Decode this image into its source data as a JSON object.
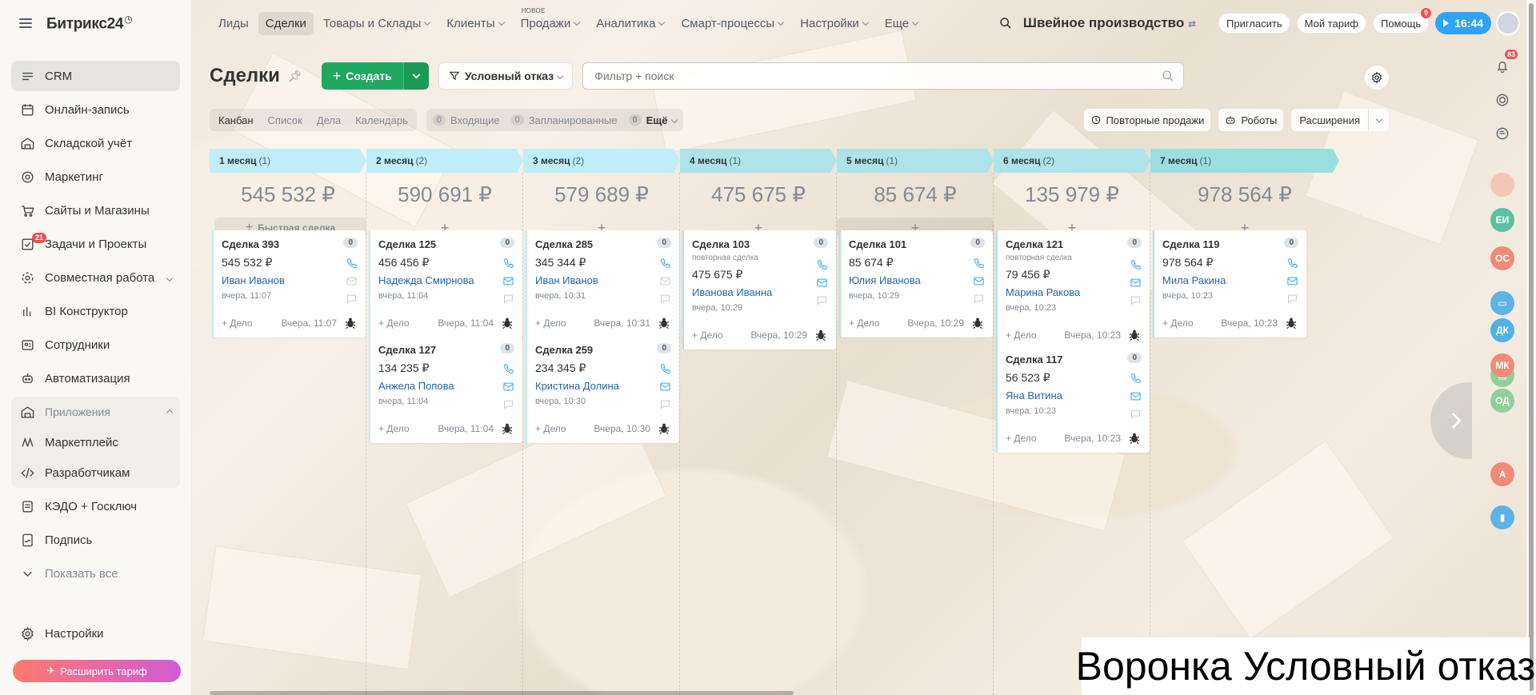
{
  "app": {
    "logo": "Битрикс24",
    "company": "Швейное производство"
  },
  "sidebar": {
    "items": [
      {
        "label": "CRM",
        "icon": "crm-icon",
        "active": true
      },
      {
        "label": "Онлайн-запись",
        "icon": "calendar-icon"
      },
      {
        "label": "Складской учёт",
        "icon": "warehouse-icon"
      },
      {
        "label": "Маркетинг",
        "icon": "marketing-icon"
      },
      {
        "label": "Сайты и Магазины",
        "icon": "cart-icon"
      },
      {
        "label": "Задачи и Проекты",
        "icon": "tasks-icon",
        "badge": "21"
      },
      {
        "label": "Совместная работа",
        "icon": "collab-icon"
      },
      {
        "label": "BI Конструктор",
        "icon": "bi-icon"
      },
      {
        "label": "Сотрудники",
        "icon": "employees-icon"
      },
      {
        "label": "Автоматизация",
        "icon": "automation-icon"
      }
    ],
    "group": {
      "header": "Приложения",
      "items": [
        {
          "label": "Маркетплейс",
          "icon": "marketplace-icon"
        },
        {
          "label": "Разработчикам",
          "icon": "code-icon"
        }
      ]
    },
    "after": [
      {
        "label": "КЭДО + Госключ",
        "icon": "doc-icon"
      },
      {
        "label": "Подпись",
        "icon": "signature-icon"
      },
      {
        "label": "Показать все",
        "icon": "chevron-down-icon",
        "muted": true
      }
    ],
    "settings": "Настройки",
    "upgrade": "Расширить тариф"
  },
  "topbar": {
    "menu": [
      {
        "label": "Лиды"
      },
      {
        "label": "Сделки",
        "active": true
      },
      {
        "label": "Товары и Склады",
        "caret": true
      },
      {
        "label": "Клиенты",
        "caret": true
      },
      {
        "label": "Продажи",
        "caret": true,
        "new": "НОВОЕ"
      },
      {
        "label": "Аналитика",
        "caret": true
      },
      {
        "label": "Смарт-процессы",
        "caret": true
      },
      {
        "label": "Настройки",
        "caret": true
      },
      {
        "label": "Еще",
        "caret": true
      }
    ],
    "invite": "Пригласить",
    "tariff": "Мой тариф",
    "help": "Помощь",
    "help_badge": "9",
    "time": "16:44"
  },
  "toolbar": {
    "title": "Сделки",
    "create": "Создать",
    "funnel": "Условный отказ",
    "filter_placeholder": "Фильтр + поиск"
  },
  "views": {
    "tabs": [
      "Канбан",
      "Список",
      "Дела",
      "Календарь"
    ],
    "counters": [
      {
        "num": "0",
        "label": "Входящие"
      },
      {
        "num": "0",
        "label": "Запланированные"
      },
      {
        "num": "0",
        "label": "Ещё"
      }
    ],
    "repeat_sales": "Повторные продажи",
    "robots": "Роботы",
    "extensions": "Расширения"
  },
  "kanban": {
    "fast_deal": "Быстрая сделка",
    "add_activity": "+ Дело",
    "columns": [
      {
        "name": "1 месяц",
        "count": "(1)",
        "sum": "545 532 ₽",
        "color": "#bfeefa",
        "cards": [
          {
            "title": "Сделка 393",
            "sum": "545 532 ₽",
            "client": "Иван Иванов",
            "date": "вчера, 11:07",
            "footer": "Вчера, 11:07",
            "cnt": "0"
          }
        ]
      },
      {
        "name": "2 месяц",
        "count": "(2)",
        "sum": "590 691 ₽",
        "color": "#bfeefa",
        "cards": [
          {
            "title": "Сделка 125",
            "sum": "456 456 ₽",
            "client": "Надежда Смирнова",
            "date": "вчера, 11:04",
            "footer": "Вчера, 11:04",
            "cnt": "0"
          },
          {
            "title": "Сделка 127",
            "sum": "134 235 ₽",
            "client": "Анжела Попова",
            "date": "вчера, 11:04",
            "footer": "Вчера, 11:04",
            "cnt": "0"
          }
        ]
      },
      {
        "name": "3 месяц",
        "count": "(2)",
        "sum": "579 689 ₽",
        "color": "#bfeefa",
        "cards": [
          {
            "title": "Сделка 285",
            "sum": "345 344 ₽",
            "client": "Иван Иванов",
            "date": "вчера, 10:31",
            "footer": "Вчера, 10:31",
            "cnt": "0"
          },
          {
            "title": "Сделка 259",
            "sum": "234 345 ₽",
            "client": "Кристина Долина",
            "date": "вчера, 10:30",
            "footer": "Вчера, 10:30",
            "cnt": "0"
          }
        ]
      },
      {
        "name": "4 месяц",
        "count": "(1)",
        "sum": "475 675 ₽",
        "color": "#aee4e9",
        "cards": [
          {
            "title": "Сделка 103",
            "sub": "повторная сделка",
            "sum": "475 675 ₽",
            "client": "Иванова Иванна",
            "date": "вчера, 10:29",
            "footer": "Вчера, 10:29",
            "cnt": "0"
          }
        ]
      },
      {
        "name": "5 месяц",
        "count": "(1)",
        "sum": "85 674 ₽",
        "color": "#aee4e9",
        "cards": [
          {
            "title": "Сделка 101",
            "sum": "85 674 ₽",
            "client": "Юлия Иванова",
            "date": "вчера, 10:29",
            "footer": "Вчера, 10:29",
            "cnt": "0"
          }
        ]
      },
      {
        "name": "6 месяц",
        "count": "(2)",
        "sum": "135 979 ₽",
        "color": "#aee4e9",
        "cards": [
          {
            "title": "Сделка 121",
            "sub": "повторная сделка",
            "sum": "79 456 ₽",
            "client": "Марина Ракова",
            "date": "вчера, 10:23",
            "footer": "Вчера, 10:23",
            "cnt": "0"
          },
          {
            "title": "Сделка 117",
            "sum": "56 523 ₽",
            "client": "Яна Витина",
            "date": "вчера, 10:23",
            "footer": "Вчера, 10:23",
            "cnt": "0"
          }
        ]
      },
      {
        "name": "7 месяц",
        "count": "(1)",
        "sum": "978 564 ₽",
        "color": "#9adfe0",
        "cards": [
          {
            "title": "Сделка 119",
            "sum": "978 564 ₽",
            "client": "Мила Ракина",
            "date": "вчера, 10:23",
            "footer": "Вчера, 10:23",
            "cnt": "0"
          }
        ]
      }
    ]
  },
  "rightbar": {
    "notif_badge": "83",
    "avatars": [
      {
        "initials": "ЕИ",
        "color": "#59c1a0"
      },
      {
        "initials": "ОС",
        "color": "#f08a79"
      },
      {
        "initials": "ДК",
        "color": "#4fb2e6"
      },
      {
        "initials": "МК",
        "color": "#f08a79"
      },
      {
        "initials": "ОД",
        "color": "#8fcf9a"
      },
      {
        "initials": "А",
        "color": "#f08a79"
      }
    ]
  },
  "caption": "Воронка Условный отказ"
}
